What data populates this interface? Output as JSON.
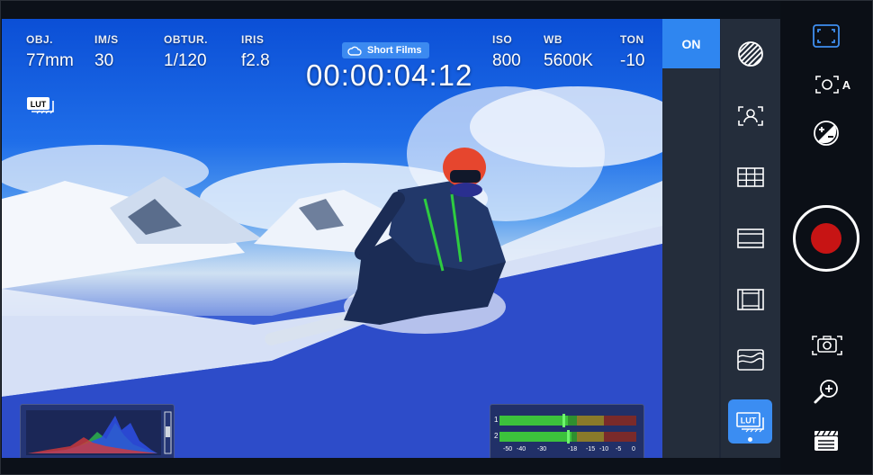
{
  "readouts": [
    {
      "label": "OBJ.",
      "value": "77mm"
    },
    {
      "label": "IM/S",
      "value": "30"
    },
    {
      "label": "OBTUR.",
      "value": "1/120"
    },
    {
      "label": "IRIS",
      "value": "f2.8"
    },
    {
      "label": "ISO",
      "value": "800"
    },
    {
      "label": "WB",
      "value": "5600K"
    },
    {
      "label": "TON",
      "value": "-10"
    }
  ],
  "project": {
    "name": "Short Films",
    "icon": "cloud-icon"
  },
  "timecode": "00:00:04:12",
  "lut_badge": "LUT",
  "side_tools": {
    "toggle_label": "ON",
    "items": [
      "zebra-icon",
      "face-detect-icon",
      "grid-icon",
      "frame-guide-icon",
      "safe-area-icon",
      "false-color-icon",
      "lut-icon"
    ],
    "lut_label": "LUT"
  },
  "controls": {
    "items": [
      "focus-frame-icon",
      "auto-exposure-icon",
      "exposure-compensation-icon",
      "record-button",
      "photo-icon",
      "zoom-icon",
      "clapperboard-icon"
    ],
    "auto_label": "A"
  },
  "audio_meter": {
    "channels": [
      "1",
      "2"
    ],
    "scale": [
      "-50",
      "-40",
      "-30",
      "-18",
      "-15",
      "-10",
      "-5",
      "0"
    ]
  },
  "colors": {
    "accent": "#2f86f0",
    "record": "#c71414",
    "meter_green": "#3cc23c",
    "meter_yellow": "#8a7a2a",
    "meter_red": "#7a2a2a"
  }
}
